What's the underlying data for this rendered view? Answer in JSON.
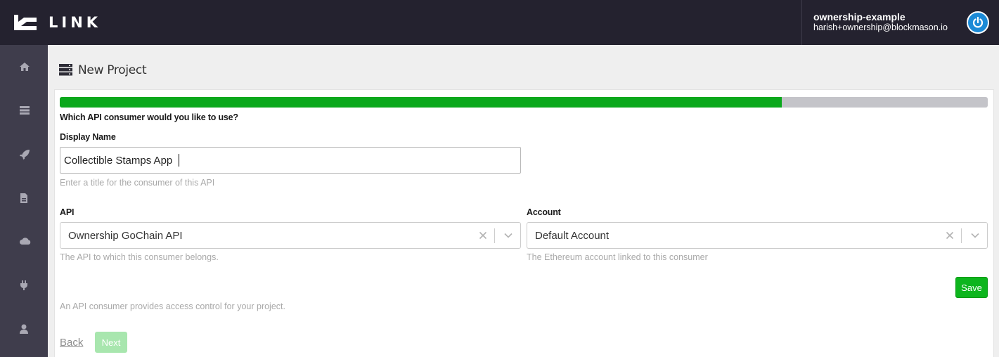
{
  "header": {
    "logo_text": "LINK",
    "user_name": "ownership-example",
    "user_email": "harish+ownership@blockmason.io",
    "power_icon": "power-icon",
    "background_color": "#24222f",
    "accent_color": "#1b8ad6"
  },
  "sidebar": {
    "items": [
      {
        "name": "home",
        "icon": "home-icon"
      },
      {
        "name": "projects",
        "icon": "server-stack-icon"
      },
      {
        "name": "deploy",
        "icon": "rocket-icon"
      },
      {
        "name": "contracts",
        "icon": "document-icon"
      },
      {
        "name": "cloud",
        "icon": "cloud-icon"
      },
      {
        "name": "plugins",
        "icon": "plug-icon"
      },
      {
        "name": "account",
        "icon": "user-icon"
      }
    ]
  },
  "page": {
    "title": "New Project",
    "icon": "server-stack-icon"
  },
  "wizard": {
    "progress_percent": 77.8,
    "progress_color": "#0aa81c",
    "question": "Which API consumer would you like to use?",
    "display_name": {
      "label": "Display Name",
      "value": "Collectible Stamps App",
      "help": "Enter a title for the consumer of this API"
    },
    "api": {
      "label": "API",
      "value": "Ownership GoChain API",
      "help": "The API to which this consumer belongs."
    },
    "account": {
      "label": "Account",
      "value": "Default Account",
      "help": "The Ethereum account linked to this consumer"
    },
    "save_label": "Save",
    "footer_help": "An API consumer provides access control for your project.",
    "back_label": "Back",
    "next_label": "Next",
    "save_color": "#0db51d"
  }
}
